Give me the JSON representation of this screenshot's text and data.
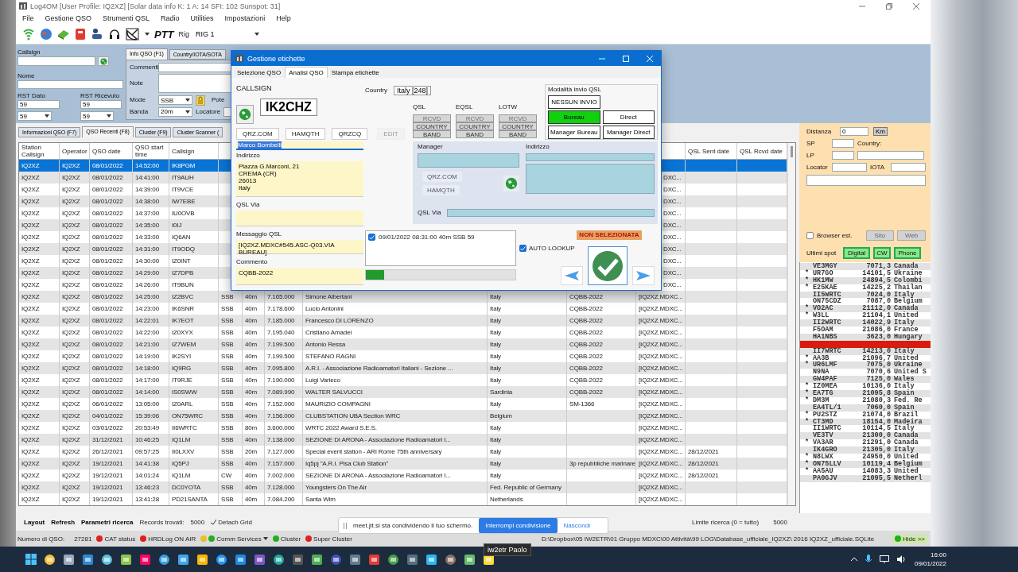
{
  "window": {
    "title": "Log4OM [User Profile: IQ2XZ] [Solar data info K: 1 A: 14 SFI: 102 Sunspot: 31]"
  },
  "menu": [
    "File",
    "Gestione QSO",
    "Strumenti QSL",
    "Radio",
    "Utilities",
    "Impostazioni",
    "Help"
  ],
  "toolbar": {
    "ptt": "PTT",
    "rig_label": "Rig",
    "rig": "RIG 1"
  },
  "qso_entry": {
    "callsign_label": "Callsign",
    "name_label": "Nome",
    "rst_sent_label": "RST Dato",
    "rst_sent": "59",
    "rst_sent_combo": "59",
    "rst_rcvd_label": "RST Ricevuto",
    "rst_rcvd": "59",
    "rst_rcvd_combo": "59"
  },
  "info_tabs": [
    {
      "label": "Info QSO (F1)",
      "selected": true
    },
    {
      "label": "Country/IOTA/SOTA",
      "selected": false
    }
  ],
  "info_qso": {
    "comments_label": "Commenti",
    "note_label": "Note",
    "mode_label": "Mode",
    "mode": "SSB",
    "power_label": "Pote",
    "band_label": "Banda",
    "band": "20m",
    "locator_label": "Locatore"
  },
  "grid_tabs": [
    {
      "label": "Informazioni QSO (F7)",
      "selected": false
    },
    {
      "label": "QSO Recenti (F8)",
      "selected": true
    },
    {
      "label": "Cluster (F9)",
      "selected": false
    },
    {
      "label": "Cluster Scanner (",
      "selected": false
    }
  ],
  "table": {
    "columns": [
      {
        "label": "Station Callsign"
      },
      {
        "label": "Operator"
      },
      {
        "label": "QSO date"
      },
      {
        "label": "QSO start time"
      },
      {
        "label": "Callsign"
      },
      {},
      {},
      {},
      {},
      {},
      {},
      {},
      {
        "label": "QSL Sent date"
      },
      {
        "label": "QSL Rcvd date"
      }
    ],
    "rows": [
      {
        "selected": true,
        "cells": [
          "IQ2XZ",
          "IQ2XZ",
          "08/01/2022",
          "14:52:00",
          "IK8PGM",
          null,
          null,
          null,
          null,
          null,
          null,
          null,
          null,
          null
        ]
      },
      {
        "selected": false,
        "cells": [
          "IQ2XZ",
          "IQ2XZ",
          "08/01/2022",
          "14:41:00",
          "IT9AUH",
          null,
          null,
          null,
          null,
          null,
          null,
          "DXC...",
          null,
          null
        ]
      },
      {
        "selected": false,
        "cells": [
          "IQ2XZ",
          "IQ2XZ",
          "08/01/2022",
          "14:39:00",
          "IT9VCE",
          null,
          null,
          null,
          null,
          null,
          null,
          "DXC...",
          null,
          null
        ]
      },
      {
        "selected": false,
        "cells": [
          "IQ2XZ",
          "IQ2XZ",
          "08/01/2022",
          "14:38:00",
          "IW7EBE",
          null,
          null,
          null,
          null,
          null,
          null,
          "DXC...",
          null,
          null
        ]
      },
      {
        "selected": false,
        "cells": [
          "IQ2XZ",
          "IQ2XZ",
          "08/01/2022",
          "14:37:00",
          "IU0OVB",
          null,
          null,
          null,
          null,
          null,
          null,
          "DXC...",
          null,
          null
        ]
      },
      {
        "selected": false,
        "cells": [
          "IQ2XZ",
          "IQ2XZ",
          "08/01/2022",
          "14:35:00",
          "I0IJ",
          null,
          null,
          null,
          null,
          null,
          null,
          "DXC...",
          null,
          null
        ]
      },
      {
        "selected": false,
        "cells": [
          "IQ2XZ",
          "IQ2XZ",
          "08/01/2022",
          "14:33:00",
          "IQ6AN",
          null,
          null,
          null,
          null,
          null,
          null,
          "DXC...",
          null,
          null
        ]
      },
      {
        "selected": false,
        "cells": [
          "IQ2XZ",
          "IQ2XZ",
          "08/01/2022",
          "14:31:00",
          "IT9ODQ",
          null,
          null,
          null,
          null,
          null,
          null,
          "DXC...",
          null,
          null
        ]
      },
      {
        "selected": false,
        "cells": [
          "IQ2XZ",
          "IQ2XZ",
          "08/01/2022",
          "14:30:00",
          "IZ0INT",
          null,
          null,
          null,
          null,
          null,
          null,
          "DXC...",
          null,
          null
        ]
      },
      {
        "selected": false,
        "cells": [
          "IQ2XZ",
          "IQ2XZ",
          "08/01/2022",
          "14:29:00",
          "IZ7DPB",
          null,
          null,
          null,
          null,
          null,
          null,
          "DXC...",
          null,
          null
        ]
      },
      {
        "selected": false,
        "cells": [
          "IQ2XZ",
          "IQ2XZ",
          "08/01/2022",
          "14:26:00",
          "IT9BUN",
          null,
          null,
          null,
          null,
          null,
          null,
          "DXC...",
          null,
          null
        ]
      },
      {
        "selected": false,
        "cells": [
          "IQ2XZ",
          "IQ2XZ",
          "08/01/2022",
          "14:25:00",
          "IZ2BVC",
          "SSB",
          "40m",
          "7.165.000",
          "Simone Albertani",
          "Italy",
          "CQBB-2022",
          "[IQ2XZ.MDXC...",
          null,
          null
        ]
      },
      {
        "selected": false,
        "cells": [
          "IQ2XZ",
          "IQ2XZ",
          "08/01/2022",
          "14:23:00",
          "IK6SNR",
          "SSB",
          "40m",
          "7.178.600",
          "Lucio Antonini",
          "Italy",
          "CQBB-2022",
          "[IQ2XZ.MDXC...",
          null,
          null
        ]
      },
      {
        "selected": false,
        "cells": [
          "IQ2XZ",
          "IQ2XZ",
          "08/01/2022",
          "14:22:01",
          "IK7EOT",
          "SSB",
          "40m",
          "7.185.000",
          "Francesco DI LORENZO",
          "Italy",
          "CQBB-2022",
          "[IQ2XZ.MDXC...",
          null,
          null
        ]
      },
      {
        "selected": false,
        "cells": [
          "IQ2XZ",
          "IQ2XZ",
          "08/01/2022",
          "14:22:00",
          "IZ0XYX",
          "SSB",
          "40m",
          "7.195.040",
          "Cristiano Amadei",
          "Italy",
          "CQBB-2022",
          "[IQ2XZ.MDXC...",
          null,
          null
        ]
      },
      {
        "selected": false,
        "cells": [
          "IQ2XZ",
          "IQ2XZ",
          "08/01/2022",
          "14:21:00",
          "IZ7WEM",
          "SSB",
          "40m",
          "7.199.500",
          "Antonio Ressa",
          "Italy",
          "CQBB-2022",
          "[IQ2XZ.MDXC...",
          null,
          null
        ]
      },
      {
        "selected": false,
        "cells": [
          "IQ2XZ",
          "IQ2XZ",
          "08/01/2022",
          "14:19:00",
          "IK2SYI",
          "SSB",
          "40m",
          "7.199.500",
          "STEFANO RAGNI",
          "Italy",
          "CQBB-2022",
          "[IQ2XZ.MDXC...",
          null,
          null
        ]
      },
      {
        "selected": false,
        "cells": [
          "IQ2XZ",
          "IQ2XZ",
          "08/01/2022",
          "14:18:00",
          "IQ9RG",
          "SSB",
          "40m",
          "7.095.800",
          "A.R.I. - Associazione Radioamatori Italiani - Sezione ...",
          "Italy",
          "CQBB-2022",
          "[IQ2XZ.MDXC...",
          null,
          null
        ]
      },
      {
        "selected": false,
        "cells": [
          "IQ2XZ",
          "IQ2XZ",
          "08/01/2022",
          "14:17:00",
          "IT9RJE",
          "SSB",
          "40m",
          "7.190.000",
          "Luigi Varieco",
          "Italy",
          "CQBB-2022",
          "[IQ2XZ.MDXC...",
          null,
          null
        ]
      },
      {
        "selected": false,
        "cells": [
          "IQ2XZ",
          "IQ2XZ",
          "08/01/2022",
          "14:14:00",
          "IS0SWW",
          "SSB",
          "40m",
          "7.089.990",
          "WALTER SALVUCCI",
          "Sardinia",
          "CQBB-2022",
          "[IQ2XZ.MDXC...",
          null,
          null
        ]
      },
      {
        "selected": false,
        "cells": [
          "IQ2XZ",
          "IQ2XZ",
          "06/01/2022",
          "13:05:00",
          "IZ0ARL",
          "SSB",
          "40m",
          "7.152.000",
          "MAURIZIO COMPAGNI",
          "Italy",
          "SM-1366",
          "[IQ2XZ.MDXC...",
          null,
          null
        ]
      },
      {
        "selected": false,
        "cells": [
          "IQ2XZ",
          "IQ2XZ",
          "04/01/2022",
          "15:39:06",
          "ON75WRC",
          "SSB",
          "40m",
          "7.156.000",
          "CLUBSTATION UBA Section WRC",
          "Belgium",
          null,
          "[IQ2XZ.MDXC...",
          null,
          null
        ]
      },
      {
        "selected": false,
        "cells": [
          "IQ2XZ",
          "IQ2XZ",
          "03/01/2022",
          "20:53:49",
          "II6WRTC",
          "SSB",
          "80m",
          "3.600.000",
          "WRTC 2022 Award S.E.S.",
          "Italy",
          null,
          "[IQ2XZ.MDXC...",
          null,
          null
        ]
      },
      {
        "selected": false,
        "cells": [
          "IQ2XZ",
          "IQ2XZ",
          "31/12/2021",
          "10:46:25",
          "IQ1LM",
          "SSB",
          "40m",
          "7.138.000",
          "SEZIONE DI ARONA - Associazione Radioamatori I...",
          "Italy",
          null,
          "[IQ2XZ.MDXC...",
          null,
          null
        ]
      },
      {
        "selected": false,
        "cells": [
          "IQ2XZ",
          "IQ2XZ",
          "26/12/2021",
          "09:57:25",
          "II0LXXV",
          "SSB",
          "20m",
          "7.127.000",
          "Special event station - ARI Rome 75th anniversary",
          "Italy",
          null,
          "[IQ2XZ.MDXC...",
          "28/12/2021",
          null
        ]
      },
      {
        "selected": false,
        "cells": [
          "IQ2XZ",
          "IQ2XZ",
          "19/12/2021",
          "14:41:38",
          "IQ5PJ",
          "SSB",
          "40m",
          "7.157.000",
          "Iq5pj \"A.R.I. Pisa Club Station\"",
          "Italy",
          "3p repubbliche marinare",
          "[IQ2XZ.MDXC...",
          "28/12/2021",
          null
        ]
      },
      {
        "selected": false,
        "cells": [
          "IQ2XZ",
          "IQ2XZ",
          "19/12/2021",
          "14:01:24",
          "IQ1LM",
          "CW",
          "40m",
          "7.002.000",
          "SEZIONE DI ARONA - Associazione Radioamatori I...",
          "Italy",
          null,
          "[IQ2XZ.MDXC...",
          "28/12/2021",
          null
        ]
      },
      {
        "selected": false,
        "cells": [
          "IQ2XZ",
          "IQ2XZ",
          "19/12/2021",
          "13:46:23",
          "DC0YOTA",
          "SSB",
          "40m",
          "7.128.000",
          "Youngsters On The Air",
          "Fed. Republic of Germany",
          null,
          "[IQ2XZ.MDXC...",
          null,
          null
        ]
      },
      {
        "selected": false,
        "cells": [
          "IQ2XZ",
          "IQ2XZ",
          "19/12/2021",
          "13:41:28",
          "PD21SANTA",
          "SSB",
          "40m",
          "7.084.200",
          "Santa Wim",
          "Netherlands",
          null,
          "[IQ2XZ.MDXC...",
          null,
          null
        ]
      }
    ]
  },
  "dialog": {
    "title": "Gestione etichette",
    "tabs": [
      {
        "label": "Selezione QSO",
        "selected": false
      },
      {
        "label": "Analisi QSO",
        "selected": true
      },
      {
        "label": "Stampa etichette",
        "selected": false
      }
    ],
    "callsign_label": "CALLSIGN",
    "callsign": "IK2CHZ",
    "lookup_buttons": [
      {
        "label": "QRZ.COM",
        "disabled": false
      },
      {
        "label": "HAMQTH",
        "disabled": false
      },
      {
        "label": "QRZCQ",
        "disabled": false
      },
      {
        "label": "EDIT",
        "disabled": true
      }
    ],
    "name": "Marco Bombelli",
    "address_label": "Indirizzo",
    "address": [
      "Piazza G.Marconi, 21",
      "CREMA (CR)",
      "26013",
      "Italy"
    ],
    "qsl_via_label": "QSL Via",
    "qsl_message_label": "Messaggio QSL",
    "qsl_message": "[IQ2XZ.MDXC#545.ASC-Q03.VIA BUREAU]",
    "comment_label": "Commento",
    "comment": "CQBB-2022",
    "country_label": "Country",
    "country": "Italy [248]",
    "confirmations": [
      {
        "label": "QSL",
        "items": [
          "RCVD",
          "COUNTRY",
          "BAND"
        ]
      },
      {
        "label": "EQSL",
        "items": [
          "RCVD",
          "COUNTRY",
          "BAND"
        ]
      },
      {
        "label": "LOTW",
        "items": [
          "RCVD",
          "COUNTRY",
          "BAND"
        ]
      }
    ],
    "send_mode": {
      "label": "Modalità invio QSL",
      "options": [
        {
          "label": "NESSUN INVIO",
          "selected": false
        },
        {
          "label": "Bureau",
          "selected": true
        },
        {
          "label": "Direct",
          "selected": false
        },
        {
          "label": "Manager Bureau",
          "selected": false
        },
        {
          "label": "Manager Direct",
          "selected": false
        }
      ]
    },
    "manager": {
      "label": "Manager",
      "buttons": [
        "QRZ.COM",
        "HAMQTH"
      ],
      "address_label": "Indirizzo",
      "qsl_via_label": "QSL Via"
    },
    "qso_list": [
      {
        "text": "09/01/2022 08:31:00 40m SSB 59",
        "checked": true
      }
    ],
    "progress": {
      "level": 0.12
    },
    "auto_lookup": {
      "label": "AUTO LOOKUP",
      "checked": true
    },
    "status_badge": "NON SELEZIONATA"
  },
  "right_panel": {
    "distance_label": "Distanza",
    "distance": "0",
    "unit": "Km",
    "sp_label": "SP",
    "country_label": "Country:",
    "lp_label": "LP",
    "locator_label": "Locator",
    "iota_label": "IOTA",
    "browser": {
      "label": "Browser est.",
      "checked": false
    },
    "site_buttons": [
      "Sito",
      "Web"
    ],
    "spots_label": "Ultimi spot",
    "spot_filters": [
      "Digital",
      "CW",
      "Phone"
    ]
  },
  "spots": [
    {
      "call": "VE3MGY",
      "freq": "7071,3",
      "country": "Canada",
      "highlighted": false
    },
    {
      "mark": "*",
      "call": "UR7GO",
      "freq": "14101,5",
      "country": "Ukraine",
      "highlighted": false
    },
    {
      "mark": "*",
      "call": "HK1MW",
      "freq": "24894,5",
      "country": "Colombi",
      "highlighted": false
    },
    {
      "mark": "*",
      "call": "E25KAE",
      "freq": "14225,2",
      "country": "Thailan",
      "highlighted": false
    },
    {
      "call": "II5WRTC",
      "freq": "7024,0",
      "country": "Italy",
      "highlighted": false
    },
    {
      "call": "ON75CDZ",
      "freq": "7087,0",
      "country": "Belgium",
      "highlighted": false
    },
    {
      "mark": "*",
      "call": "VO2AC",
      "freq": "21112,0",
      "country": "Canada",
      "highlighted": false
    },
    {
      "mark": "*",
      "call": "W3LL",
      "freq": "21104,1",
      "country": "United",
      "highlighted": false
    },
    {
      "call": "II2WRTC",
      "freq": "14022,9",
      "country": "Italy",
      "highlighted": false
    },
    {
      "call": "F5OAM",
      "freq": "21086,0",
      "country": "France",
      "highlighted": false
    },
    {
      "call": "HA1NBS",
      "freq": "3623,0",
      "country": "Hungary",
      "highlighted": false
    },
    {
      "highlighted": true
    },
    {
      "call": "II7WRTC",
      "freq": "14213,0",
      "country": "Italy",
      "highlighted": false
    },
    {
      "mark": "*",
      "call": "AA3B",
      "freq": "21096,7",
      "country": "United",
      "highlighted": false
    },
    {
      "mark": "*",
      "call": "UR6LMF",
      "freq": "7075,0",
      "country": "Ukraine",
      "highlighted": false
    },
    {
      "call": "N9NA",
      "freq": "7070,6",
      "country": "United S",
      "highlighted": false
    },
    {
      "call": "GW4PAF",
      "freq": "7125,0",
      "country": "Wales",
      "highlighted": false
    },
    {
      "mark": "*",
      "call": "IZ0MEA",
      "freq": "10136,0",
      "country": "Italy",
      "highlighted": false
    },
    {
      "mark": "*",
      "call": "EA7TG",
      "freq": "21095,8",
      "country": "Spain",
      "highlighted": false
    },
    {
      "mark": "*",
      "call": "DM3M",
      "freq": "21080,3",
      "country": "Fed. Re",
      "highlighted": false
    },
    {
      "call": "EA4TL/1",
      "freq": "7060,0",
      "country": "Spain",
      "highlighted": false
    },
    {
      "mark": "*",
      "call": "PU2STZ",
      "freq": "21074,0",
      "country": "Brazil",
      "highlighted": false
    },
    {
      "mark": "*",
      "call": "CT3MD",
      "freq": "18154,0",
      "country": "Madeira",
      "highlighted": false
    },
    {
      "call": "II1WRTC",
      "freq": "10114,5",
      "country": "Italy",
      "highlighted": false
    },
    {
      "call": "VE3TV",
      "freq": "21300,0",
      "country": "Canada",
      "highlighted": false
    },
    {
      "mark": "*",
      "call": "VA3AR",
      "freq": "21291,0",
      "country": "Canada",
      "highlighted": false
    },
    {
      "call": "IK4GRO",
      "freq": "21305,0",
      "country": "Italy",
      "highlighted": false
    },
    {
      "mark": "*",
      "call": "N8LWX",
      "freq": "24950,0",
      "country": "United",
      "highlighted": false
    },
    {
      "mark": "*",
      "call": "ON75LLV",
      "freq": "10119,4",
      "country": "Belgium",
      "highlighted": false
    },
    {
      "mark": "*",
      "call": "AA5AU",
      "freq": "14083,3",
      "country": "United",
      "highlighted": false
    },
    {
      "call": "PA0GJV",
      "freq": "21095,5",
      "country": "Netherl",
      "highlighted": false
    }
  ],
  "bottom_bar": {
    "layout": "Layout",
    "refresh": "Refresh",
    "search_params": "Parametri ricerca",
    "records_label": "Records trovati:",
    "records": "5000",
    "detach": "Detach Grid",
    "limit_label": "Limite ricerca (0 = tutto)",
    "limit": "5000"
  },
  "screen_share": {
    "message": "meet.jit.si sta condividendo il tuo schermo.",
    "stop": "Interrompi condivisione",
    "hide": "Nascondi"
  },
  "status_bar": {
    "qso_count_label": "Numero di QSO:",
    "qso_count": "27281",
    "indicators": [
      {
        "label": "CAT status",
        "dots": [
          {
            "color": "#e02020"
          }
        ],
        "dropdown": false
      },
      {
        "label": "HRDLog ON AIR",
        "dots": [
          {
            "color": "#e02020"
          }
        ],
        "dropdown": false
      },
      {
        "label": "Comm Services",
        "dots": [
          {
            "color": "#e8c020"
          },
          {
            "color": "#20b020"
          }
        ],
        "dropdown": true
      },
      {
        "label": "Cluster",
        "dots": [
          {
            "color": "#20b020"
          }
        ],
        "dropdown": false
      },
      {
        "label": "Super Cluster",
        "dots": [
          {
            "color": "#e02020"
          }
        ],
        "dropdown": false
      }
    ],
    "path": "D:\\Dropbox\\05 IW2ETR\\01 Gruppo MDXC\\00 Attività\\99 LOG\\Database_ufficiale_IQ2XZ\\ 2016 IQ2XZ_ufficiale.SQLite",
    "hide": {
      "label": "Hide >>",
      "color": "#20b020"
    }
  },
  "tooltip": "iw2etr Paolo",
  "taskbar": {
    "time": "16:00",
    "date": "09/01/2022"
  }
}
